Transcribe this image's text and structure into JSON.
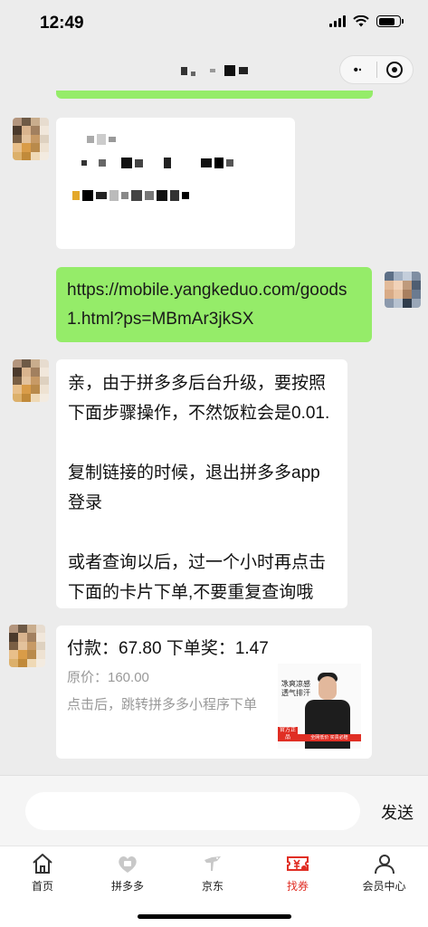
{
  "status_bar": {
    "time": "12:49"
  },
  "nav": {
    "capsule_more": "•·"
  },
  "messages": {
    "link": "https://mobile.yangkeduo.com/goods1.html?ps=MBmAr3jkSX",
    "notice_lines": [
      "亲，由于拼多多后台升级，要按照下面步骤操作，不然饭粒会是0.01.",
      "复制链接的时候，退出拼多多app登录",
      "或者查询以后，过一个小时再点击下面的卡片下单,不要重复查询哦"
    ],
    "card": {
      "price_line": "付款：67.80 下单奖：1.47",
      "original_price": "原价：160.00",
      "tip": "点击后，跳转拼多多小程序下单",
      "image": {
        "tag_text": "冰爽凉感透气排汗",
        "badge_text": "官方正品",
        "strip_text": "全网低价 买贵必赔"
      }
    }
  },
  "input": {
    "placeholder": "",
    "send_label": "发送"
  },
  "tabs": [
    {
      "label": "首页",
      "icon": "home-icon",
      "active": false
    },
    {
      "label": "拼多多",
      "icon": "pinduoduo-icon",
      "active": false
    },
    {
      "label": "京东",
      "icon": "jd-icon",
      "active": false
    },
    {
      "label": "找券",
      "icon": "coupon-icon",
      "active": true
    },
    {
      "label": "会员中心",
      "icon": "user-icon",
      "active": false
    }
  ],
  "colors": {
    "accent": "#e02e24",
    "self_bubble": "#95ec69",
    "background": "#ececec"
  }
}
